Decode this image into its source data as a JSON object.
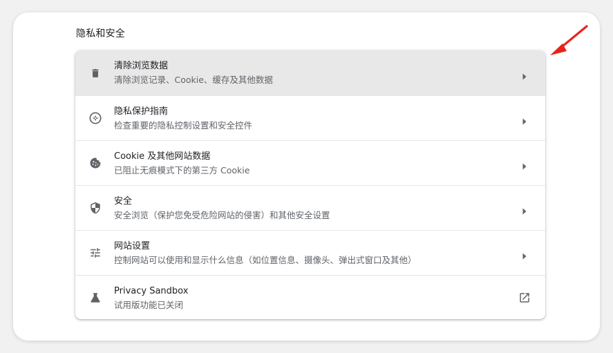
{
  "section": {
    "title": "隐私和安全"
  },
  "rows": [
    {
      "title": "清除浏览数据",
      "subtitle": "清除浏览记录、Cookie、缓存及其他数据",
      "icon": "trash-icon",
      "trailing": "arrow-right-icon",
      "highlighted": true
    },
    {
      "title": "隐私保护指南",
      "subtitle": "检查重要的隐私控制设置和安全控件",
      "icon": "compass-icon",
      "trailing": "arrow-right-icon",
      "highlighted": false
    },
    {
      "title": "Cookie 及其他网站数据",
      "subtitle": "已阻止无痕模式下的第三方 Cookie",
      "icon": "cookie-icon",
      "trailing": "arrow-right-icon",
      "highlighted": false
    },
    {
      "title": "安全",
      "subtitle": "安全浏览（保护您免受危险网站的侵害）和其他安全设置",
      "icon": "shield-icon",
      "trailing": "arrow-right-icon",
      "highlighted": false
    },
    {
      "title": "网站设置",
      "subtitle": "控制网站可以使用和显示什么信息（如位置信息、摄像头、弹出式窗口及其他）",
      "icon": "tune-icon",
      "trailing": "arrow-right-icon",
      "highlighted": false
    },
    {
      "title": "Privacy Sandbox",
      "subtitle": "试用版功能已关闭",
      "icon": "flask-icon",
      "trailing": "open-in-new-icon",
      "highlighted": false
    }
  ],
  "colors": {
    "highlight_row": "#e8e8e8",
    "icon": "#5f6368",
    "text_primary": "#202124",
    "text_secondary": "#5f6368",
    "annotation_arrow": "#e8231a"
  }
}
